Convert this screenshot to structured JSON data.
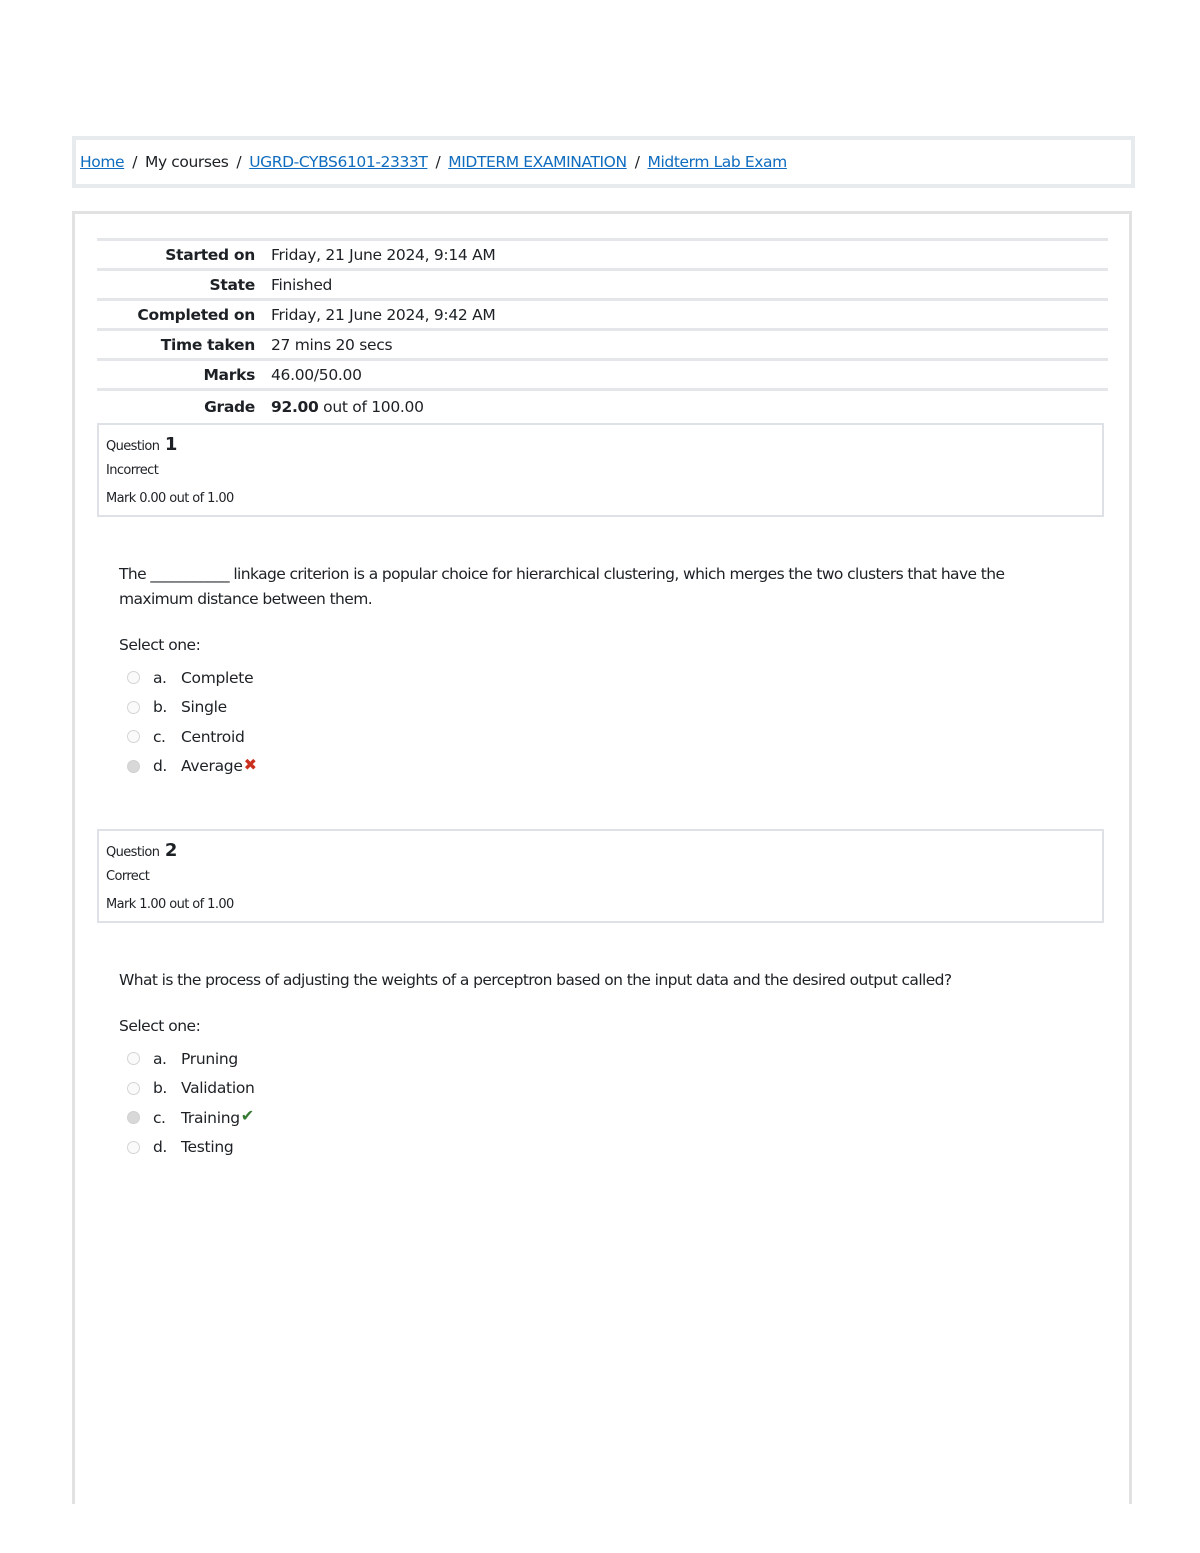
{
  "breadcrumb": [
    {
      "label": "Home",
      "link": true
    },
    {
      "label": "My courses",
      "link": false
    },
    {
      "label": "UGRD-CYBS6101-2333T",
      "link": true
    },
    {
      "label": "MIDTERM EXAMINATION",
      "link": true
    },
    {
      "label": "Midterm Lab Exam",
      "link": true
    }
  ],
  "breadcrumb_separator": "/",
  "summary": [
    {
      "label": "Started on",
      "value": "Friday, 21 June 2024, 9:14 AM"
    },
    {
      "label": "State",
      "value": "Finished"
    },
    {
      "label": "Completed on",
      "value": "Friday, 21 June 2024, 9:42 AM"
    },
    {
      "label": "Time taken",
      "value": "27 mins 20 secs"
    },
    {
      "label": "Marks",
      "value": "46.00/50.00"
    },
    {
      "label": "Grade",
      "value_bold": "92.00",
      "value": "out of 100.00"
    }
  ],
  "questions": [
    {
      "label": "Question",
      "number": "1",
      "state": "Incorrect",
      "mark": "Mark 0.00 out of 1.00",
      "text": "The ___________ linkage criterion is a popular choice for hierarchical clustering, which merges the two clusters that have the maximum distance between them.",
      "prompt": "Select one:",
      "answers": [
        {
          "letter": "a.",
          "text": "Complete",
          "selected": false
        },
        {
          "letter": "b.",
          "text": "Single",
          "selected": false
        },
        {
          "letter": "c.",
          "text": "Centroid",
          "selected": false
        },
        {
          "letter": "d.",
          "text": "Average",
          "selected": true,
          "feedback_icon": "incorrect-x-icon",
          "glyph": "✖"
        }
      ]
    },
    {
      "label": "Question",
      "number": "2",
      "state": "Correct",
      "mark": "Mark 1.00 out of 1.00",
      "text": "What is the process of adjusting the weights of a perceptron based on the input data and the desired output called?",
      "prompt": "Select one:",
      "answers": [
        {
          "letter": "a.",
          "text": "Pruning",
          "selected": false
        },
        {
          "letter": "b.",
          "text": "Validation",
          "selected": false
        },
        {
          "letter": "c.",
          "text": "Training",
          "selected": true,
          "feedback_icon": "correct-check-icon",
          "glyph": "✔"
        },
        {
          "letter": "d.",
          "text": "Testing",
          "selected": false
        }
      ]
    }
  ],
  "colors": {
    "link": "#0f6cbf",
    "incorrect": "#ca3120",
    "correct": "#357a32"
  }
}
